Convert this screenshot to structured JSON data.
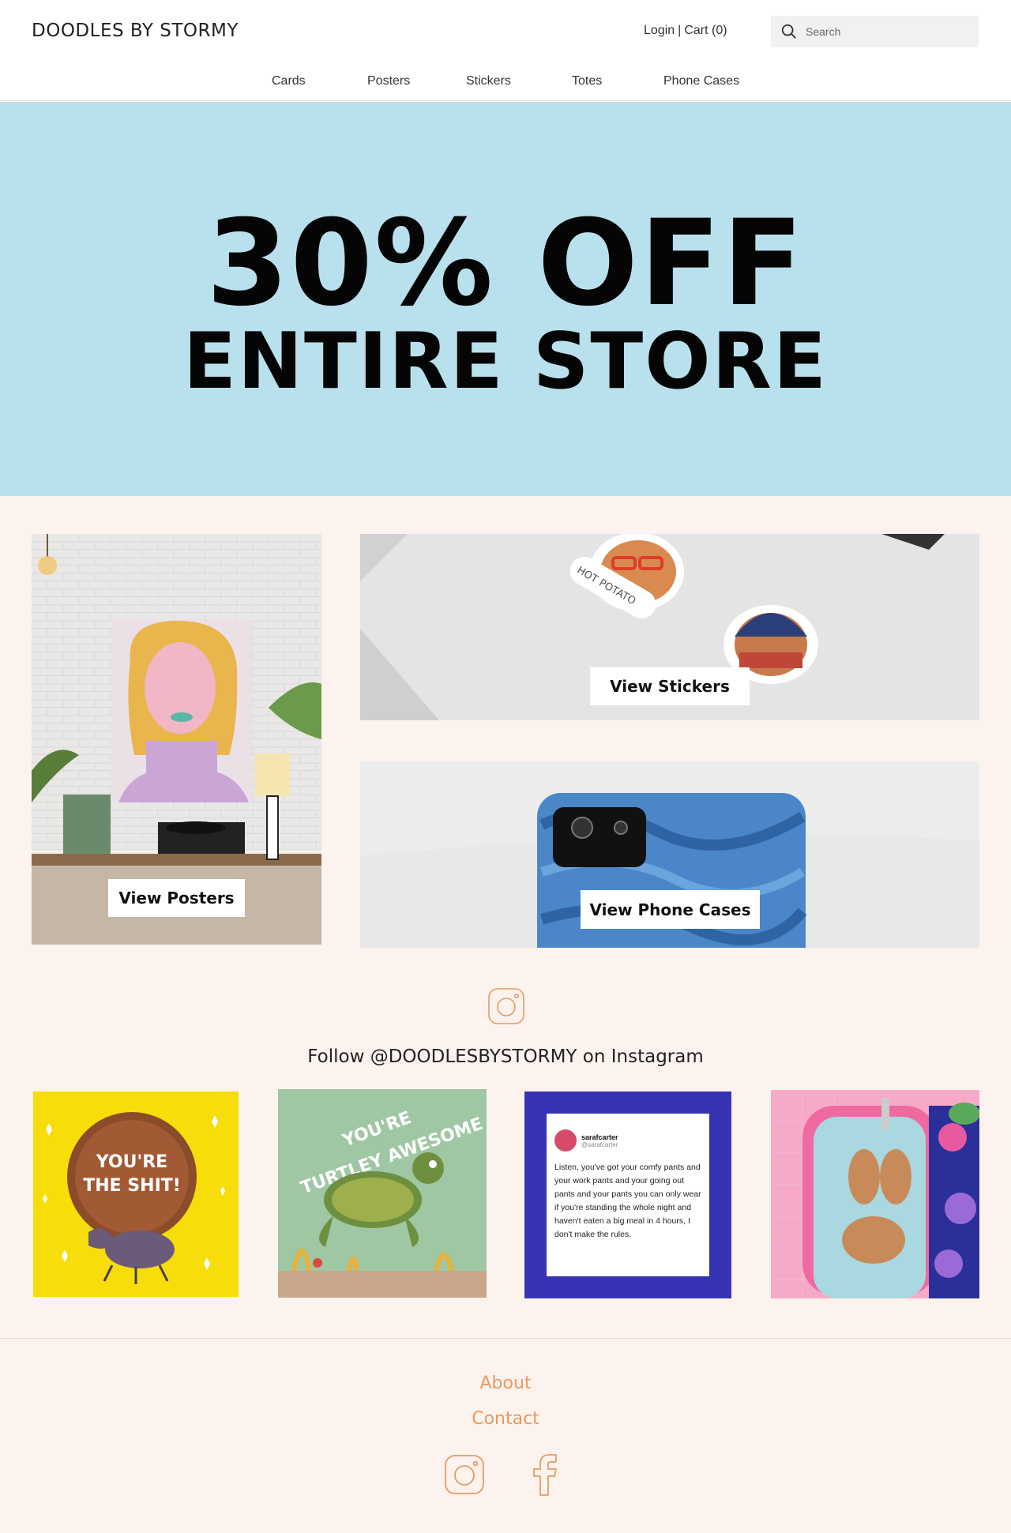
{
  "header": {
    "logo": "DOODLES BY STORMY",
    "login_label": "Login",
    "separator": "|",
    "cart_label": "Cart (0)",
    "search_placeholder": "Search"
  },
  "nav": {
    "items": [
      {
        "label": "Cards"
      },
      {
        "label": "Posters"
      },
      {
        "label": "Stickers"
      },
      {
        "label": "Totes"
      },
      {
        "label": "Phone Cases"
      }
    ]
  },
  "hero": {
    "line1": "30% OFF",
    "line2": "ENTIRE STORE",
    "background": "#b8e1ed"
  },
  "tiles": {
    "posters_label": "View Posters",
    "stickers_label": "View Stickers",
    "phone_cases_label": "View Phone Cases",
    "sticker_caption": "HOT POTATO"
  },
  "instagram": {
    "follow_text": "Follow @DOODLESBYSTORMY on Instagram",
    "posts": [
      {
        "text_line1": "YOU'RE",
        "text_line2": "THE SHIT!"
      },
      {
        "text_line1": "YOU'RE",
        "text_line2": "TURTLEY AWESOME"
      },
      {
        "user": "sarafcarter",
        "handle": "@sarafcarter",
        "tweet": "Listen, you've got your comfy pants and your work pants and your going out pants and your pants you can only wear if you're standing the whole night and haven't eaten a big meal in 4 hours, I don't make the rules."
      },
      {}
    ]
  },
  "footer": {
    "about_label": "About",
    "contact_label": "Contact"
  },
  "colors": {
    "accent": "#e89a5e",
    "page_bg": "#fcf3ef"
  },
  "icons": [
    "search-icon",
    "instagram-icon",
    "facebook-icon"
  ]
}
